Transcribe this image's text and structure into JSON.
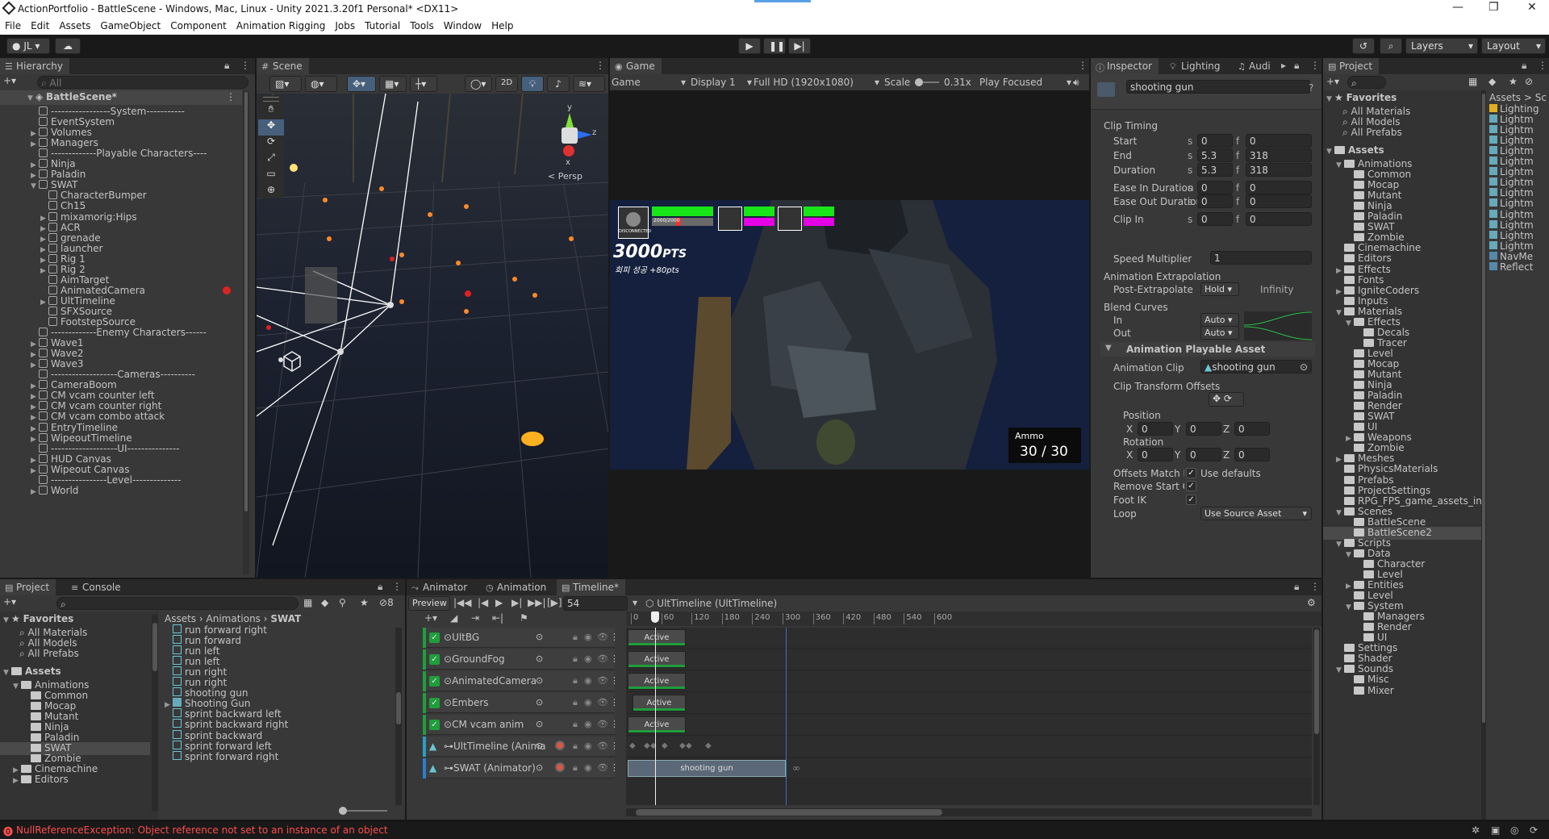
{
  "window": {
    "title": "ActionPortfolio - BattleScene - Windows, Mac, Linux - Unity 2021.3.20f1 Personal* <DX11>",
    "minimize": "—",
    "maximize": "❐",
    "close": "✕"
  },
  "menu": [
    "File",
    "Edit",
    "Assets",
    "GameObject",
    "Component",
    "Animation Rigging",
    "Jobs",
    "Tutorial",
    "Tools",
    "Window",
    "Help"
  ],
  "toolbar": {
    "account": "JL ▾",
    "layers": "Layers",
    "layout": "Layout"
  },
  "hierarchy": {
    "tab": "Hierarchy",
    "search_placeholder": "All",
    "scene": "BattleScene*",
    "items": [
      "-----------------System-----------",
      "EventSystem",
      "Volumes",
      "Managers",
      "-------------Playable Characters----",
      "Ninja",
      "Paladin",
      "SWAT",
      "CharacterBumper",
      "Ch15",
      "mixamorig:Hips",
      "ACR",
      "grenade",
      "launcher",
      "Rig 1",
      "Rig 2",
      "AimTarget",
      "AnimatedCamera",
      "UltTimeline",
      "SFXSource",
      "FootstepSource",
      "-------------Enemy Characters------",
      "Wave1",
      "Wave2",
      "Wave3",
      "-------------------Cameras----------",
      "CameraBoom",
      "CM vcam counter left",
      "CM vcam counter right",
      "CM vcam combo attack",
      "EntryTimeline",
      "WipeoutTimeline",
      "-------------------UI---------------",
      "HUD Canvas",
      "Wipeout Canvas",
      "----------------Level--------------",
      "World"
    ]
  },
  "scene": {
    "tab": "Scene",
    "mode2d": "2D",
    "persp": "< Persp",
    "axis_y": "y",
    "axis_x": "x",
    "axis_z": "z"
  },
  "game": {
    "tab": "Game",
    "mode": "Game",
    "display": "Display 1",
    "resolution": "Full HD (1920x1080)",
    "scale_label": "Scale",
    "scale_value": "0.31x",
    "play_focused": "Play Focused",
    "points": "3000",
    "points_suffix": "PTS",
    "bonus": "회피 성공 +80pts",
    "hp_text": "2000/2000",
    "disconnected": "DISCONNECTED",
    "ammo_label": "Ammo",
    "ammo_current": "30",
    "ammo_sep": "/",
    "ammo_max": "30"
  },
  "inspector": {
    "tabs": [
      "Inspector",
      "Lighting",
      "Audi"
    ],
    "object_name": "shooting gun",
    "clip_timing": "Clip Timing",
    "rows": [
      {
        "label": "Start",
        "s": "0",
        "f": "0"
      },
      {
        "label": "End",
        "s": "5.3",
        "f": "318"
      },
      {
        "label": "Duration",
        "s": "5.3",
        "f": "318"
      },
      {
        "label": "Ease In Duration",
        "s": "0",
        "f": "0"
      },
      {
        "label": "Ease Out Duration",
        "s": "0",
        "f": "0"
      },
      {
        "label": "Clip In",
        "s": "0",
        "f": "0"
      }
    ],
    "s_unit": "s",
    "f_unit": "f",
    "speed_label": "Speed Multiplier",
    "speed_value": "1",
    "extrapolation": "Animation Extrapolation",
    "post_label": "Post-Extrapolate",
    "post_value": "Hold",
    "post_extra": "Infinity",
    "blend_curves": "Blend Curves",
    "in_label": "In",
    "out_label": "Out",
    "auto": "Auto",
    "playable_header": "Animation Playable Asset",
    "anim_clip_label": "Animation Clip",
    "anim_clip_value": "shooting gun",
    "offsets_label": "Clip Transform Offsets",
    "position": "Position",
    "rotation": "Rotation",
    "x": "X",
    "y": "Y",
    "z": "Z",
    "zero": "0",
    "match_label": "Offsets Match Fiel",
    "use_defaults": "Use defaults",
    "remove_label": "Remove Start Offs",
    "footik_label": "Foot IK",
    "loop_label": "Loop",
    "loop_value": "Use Source Asset",
    "check": "✓"
  },
  "project_right": {
    "tab": "Project",
    "favorites": "Favorites",
    "fav_items": [
      "All Materials",
      "All Models",
      "All Prefabs"
    ],
    "assets": "Assets",
    "tree": [
      "Animations",
      "Common",
      "Mocap",
      "Mutant",
      "Ninja",
      "Paladin",
      "SWAT",
      "Zombie",
      "Cinemachine",
      "Editors",
      "Effects",
      "Fonts",
      "IgniteCoders",
      "Inputs",
      "Materials",
      "Effects",
      "Decals",
      "Tracer",
      "Level",
      "Mocap",
      "Mutant",
      "Ninja",
      "Paladin",
      "Render",
      "SWAT",
      "UI",
      "Weapons",
      "Zombie",
      "Meshes",
      "PhysicsMaterials",
      "Prefabs",
      "ProjectSettings",
      "RPG_FPS_game_assets_in",
      "Scenes",
      "BattleScene",
      "BattleScene2",
      "Scripts",
      "Data",
      "Character",
      "Level",
      "Entities",
      "Level",
      "System",
      "Managers",
      "Render",
      "UI",
      "Settings",
      "Shader",
      "Sounds",
      "Misc",
      "Mixer"
    ],
    "crumb": "Assets > Sc",
    "files": [
      "Lighting",
      "Lightm",
      "Lightm",
      "Lightm",
      "Lightm",
      "Lightm",
      "Lightm",
      "Lightm",
      "Lightm",
      "Lightm",
      "Lightm",
      "Lightm",
      "Lightm",
      "Lightm",
      "NavMe",
      "Reflect"
    ]
  },
  "project_bottom": {
    "tabs": [
      "Project",
      "Console"
    ],
    "favorites": "Favorites",
    "fav_items": [
      "All Materials",
      "All Models",
      "All Prefabs"
    ],
    "assets": "Assets",
    "tree": [
      "Animations",
      "Common",
      "Mocap",
      "Mutant",
      "Ninja",
      "Paladin",
      "SWAT",
      "Zombie",
      "Cinemachine",
      "Editors"
    ],
    "crumb": [
      "Assets",
      "Animations",
      "SWAT"
    ],
    "files": [
      "run forward right",
      "run forward",
      "run left",
      "run left",
      "run right",
      "run right",
      "shooting gun",
      "Shooting Gun",
      "sprint backward left",
      "sprint backward right",
      "sprint backward",
      "sprint forward left",
      "sprint forward right"
    ],
    "count": "8"
  },
  "timeline": {
    "tabs": [
      "Animator",
      "Animation",
      "Timeline*"
    ],
    "preview": "Preview",
    "frame": "54",
    "asset": "UltTimeline (UltTimeline)",
    "ticks": [
      "0",
      "60",
      "120",
      "180",
      "240",
      "300",
      "360",
      "420",
      "480",
      "540",
      "600"
    ],
    "tracks": [
      "UltBG",
      "GroundFog",
      "AnimatedCamera",
      "Embers",
      "CM vcam anim",
      "UltTimeline (Animat",
      "SWAT (Animator)"
    ],
    "clip_active": "Active",
    "clip_shooting": "shooting gun",
    "infinity": "∞"
  },
  "status": {
    "error": "NullReferenceException: Object reference not set to an instance of an object"
  },
  "colors": {
    "bg": "#383838",
    "tab": "#282828",
    "accent_green": "#1f9e3c",
    "hud_green": "#19e619",
    "hud_magenta": "#e600e6",
    "error_red": "#ff4e4e",
    "selection": "#2c5d87"
  }
}
